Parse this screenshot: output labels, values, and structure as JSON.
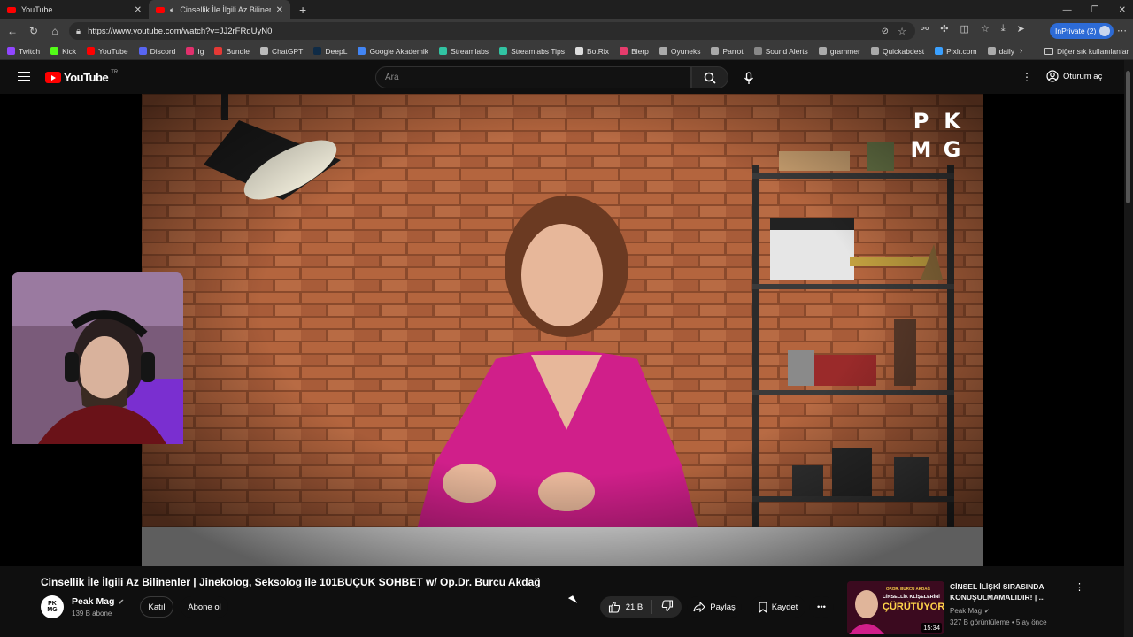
{
  "browser": {
    "tabs": [
      {
        "title": "YouTube"
      },
      {
        "title": "Cinsellik İle İlgili Az Bilinenler"
      }
    ],
    "url": "https://www.youtube.com/watch?v=JJ2rFRqUyN0",
    "inprivate_label": "InPrivate (2)",
    "bookmarks": [
      {
        "label": "Twitch",
        "color": "#9146ff"
      },
      {
        "label": "Kick",
        "color": "#53fc18"
      },
      {
        "label": "YouTube",
        "color": "#ff0000"
      },
      {
        "label": "Discord",
        "color": "#5865f2"
      },
      {
        "label": "Ig",
        "color": "#e1306c"
      },
      {
        "label": "Bundle",
        "color": "#e53935"
      },
      {
        "label": "ChatGPT",
        "color": "#bbbbbb"
      },
      {
        "label": "DeepL",
        "color": "#0f2b46"
      },
      {
        "label": "Google Akademik",
        "color": "#4285f4"
      },
      {
        "label": "Streamlabs",
        "color": "#31c3a2"
      },
      {
        "label": "Streamlabs Tips",
        "color": "#31c3a2"
      },
      {
        "label": "BotRix",
        "color": "#dddddd"
      },
      {
        "label": "Blerp",
        "color": "#e63c6c"
      },
      {
        "label": "Oyuneks",
        "color": "#aaaaaa"
      },
      {
        "label": "Parrot",
        "color": "#aaaaaa"
      },
      {
        "label": "Sound Alerts",
        "color": "#888888"
      },
      {
        "label": "grammer",
        "color": "#aaaaaa"
      },
      {
        "label": "Quickabdest",
        "color": "#aaaaaa"
      },
      {
        "label": "Pixlr.com",
        "color": "#3aa0ff"
      },
      {
        "label": "daily",
        "color": "#aaaaaa"
      }
    ],
    "other_bookmarks": "Diğer sık kullanılanlar"
  },
  "youtube": {
    "logo": "YouTube",
    "region": "TR",
    "search_placeholder": "Ara",
    "signin": "Oturum aç"
  },
  "overlay": {
    "brand": [
      "P",
      "K",
      "M",
      "G"
    ]
  },
  "video": {
    "title": "Cinsellik İle İlgili Az Bilinenler | Jinekolog, Seksolog ile 101BUÇUK SOHBET w/ Op.Dr. Burcu Akdağ",
    "channel": "Peak Mag",
    "channel_avatar": "PK\nMG",
    "subscribers": "139 B abone",
    "join": "Katıl",
    "subscribe": "Abone ol",
    "likes": "21 B",
    "share": "Paylaş",
    "save": "Kaydet"
  },
  "recommended": {
    "title": "CİNSEL İLİŞKİ SIRASINDA KONUŞULMAMALIDIR! | ...",
    "channel": "Peak Mag",
    "meta": "327 B görüntüleme • 5 ay önce",
    "duration": "15:34",
    "thumb_line1": "OP.DR. BURCU AKDAĞ",
    "thumb_line2": "CİNSELLİK KLİŞELERİNİ",
    "thumb_line3": "ÇÜRÜTÜYOR!"
  }
}
